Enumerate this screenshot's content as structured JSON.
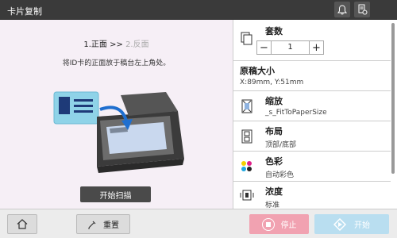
{
  "window": {
    "title": "卡片复制"
  },
  "steps": {
    "step1": "1.正面",
    "separator": ">>",
    "step2": "2.反面"
  },
  "instruction": "将ID卡的正面放于稿台左上角处。",
  "start_scan_label": "开始扫描",
  "settings": {
    "copies": {
      "label": "套数",
      "value": "1",
      "minus": "−",
      "plus": "+"
    },
    "original_size": {
      "label": "原稿大小",
      "value": "X:89mm, Y:51mm"
    },
    "zoom": {
      "label": "缩放",
      "value": "_s_FitToPaperSize"
    },
    "layout": {
      "label": "布局",
      "value": "顶部/底部"
    },
    "color": {
      "label": "色彩",
      "value": "自动彩色"
    },
    "density": {
      "label": "浓度",
      "value": "标准"
    }
  },
  "bottom": {
    "reset": "重置",
    "stop": "停止",
    "start": "开始"
  },
  "colors": {
    "accent": "#3a3a3a",
    "stop": "#f1a2b1",
    "start": "#b9def0"
  }
}
